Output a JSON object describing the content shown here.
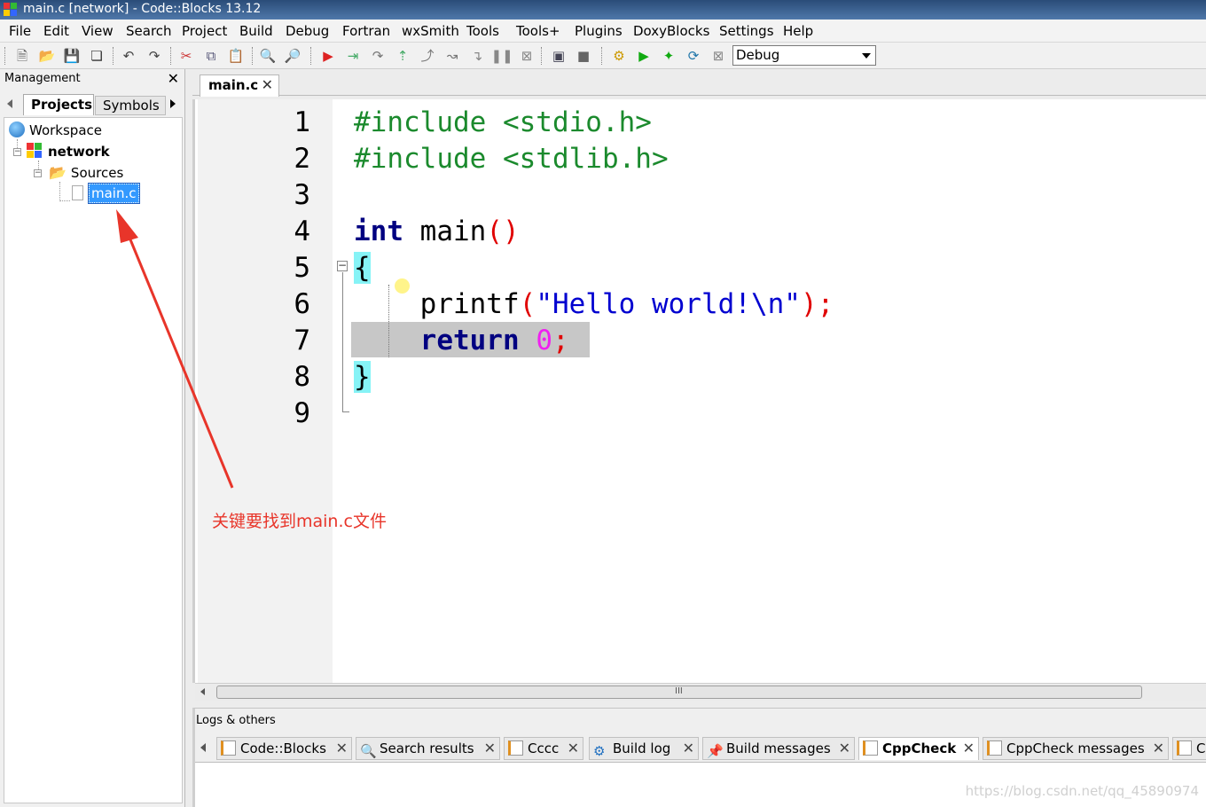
{
  "window": {
    "title": "main.c [network] - Code::Blocks 13.12"
  },
  "menu": [
    "File",
    "Edit",
    "View",
    "Search",
    "Project",
    "Build",
    "Debug",
    "Fortran",
    "wxSmith",
    "Tools",
    "Tools+",
    "Plugins",
    "DoxyBlocks",
    "Settings",
    "Help"
  ],
  "toolbar": {
    "build_target": "Debug",
    "icons": [
      "new-file-icon",
      "open-icon",
      "save-icon",
      "save-all-icon",
      "undo-icon",
      "redo-icon",
      "cut-icon",
      "copy-icon",
      "paste-icon",
      "find-icon",
      "replace-icon",
      "debug-run-icon",
      "step-into-icon",
      "step-over-icon",
      "step-out-icon",
      "next-instruction-icon",
      "step-instruction-icon",
      "run-to-cursor-icon",
      "break-icon",
      "stop-debug-icon",
      "debug-windows-icon",
      "info-icon",
      "build-icon",
      "run-icon",
      "build-run-icon",
      "rebuild-icon",
      "abort-icon"
    ]
  },
  "management": {
    "title": "Management",
    "tabs": [
      "Projects",
      "Symbols"
    ],
    "tree": {
      "workspace": "Workspace",
      "project": "network",
      "folder": "Sources",
      "file": "main.c"
    }
  },
  "editor": {
    "tab": "main.c",
    "line_numbers": [
      "1",
      "2",
      "3",
      "4",
      "5",
      "6",
      "7",
      "8",
      "9"
    ],
    "code": [
      "#include <stdio.h>",
      "#include <stdlib.h>",
      "",
      "int main()",
      "{",
      "    printf(\"Hello world!\\n\");",
      "    return 0;",
      "}",
      ""
    ]
  },
  "annotation": {
    "text": "关键要找到main.c文件",
    "color": "#e8352a"
  },
  "logs": {
    "title": "Logs & others",
    "tabs": [
      "Code::Blocks",
      "Search results",
      "Cccc",
      "Build log",
      "Build messages",
      "CppCheck",
      "CppCheck messages",
      "Cs"
    ],
    "active_tab": "CppCheck"
  },
  "watermark": "https://blog.csdn.net/qq_45890974",
  "colors": {
    "preprocessor": "#1b8a2d",
    "keyword": "#000080",
    "string": "#0000d0",
    "number": "#f020f0",
    "brace_highlight": "#86f3f6",
    "current_line": "#c7c7c7"
  }
}
